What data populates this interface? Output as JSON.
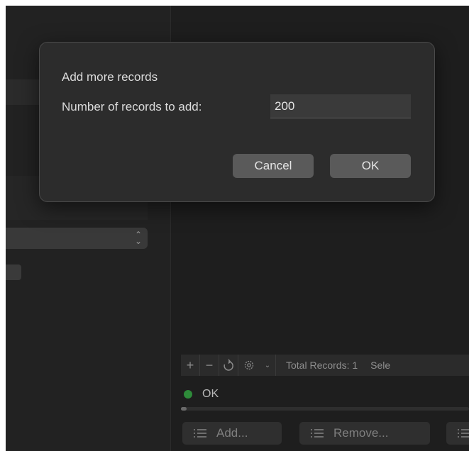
{
  "dialog": {
    "title": "Add more records",
    "count_label": "Number of records to add:",
    "count_value": "200",
    "cancel_label": "Cancel",
    "ok_label": "OK"
  },
  "toolbar": {
    "add_icon": "plus-icon",
    "remove_icon": "minus-icon",
    "refresh_icon": "refresh-icon",
    "gear_icon": "gear-icon",
    "caret_icon": "chevron-down-icon",
    "total_records": "Total Records: 1",
    "selected_label": "Sele"
  },
  "status": {
    "text": "OK",
    "dot_color": "#2e8b3a"
  },
  "bottom_buttons": {
    "add_label": "Add...",
    "remove_label": "Remove..."
  },
  "colors": {
    "background": "#1e1e1e",
    "dialog": "#2c2c2c",
    "button": "#5a5a5a"
  }
}
